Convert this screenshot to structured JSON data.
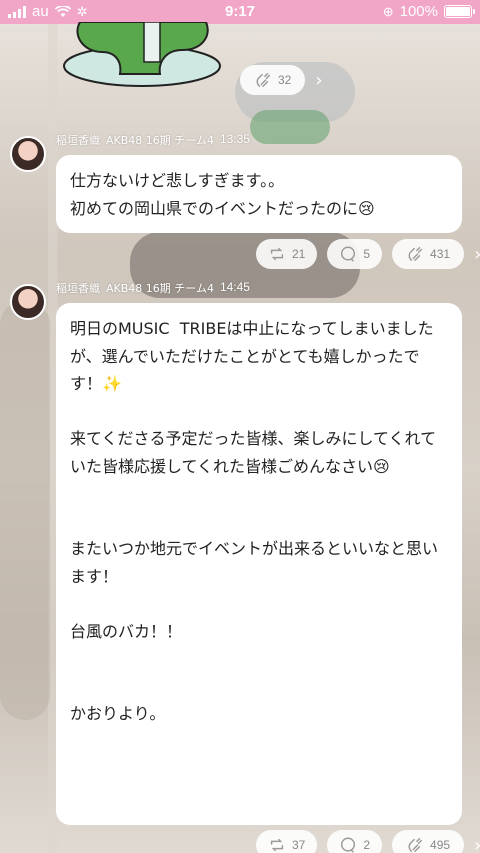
{
  "status_bar": {
    "carrier": "au",
    "time": "9:17",
    "battery": "100%",
    "battery_level": 1.0
  },
  "top_post": {
    "reactions": [
      {
        "icon": "clap-icon",
        "count": "32"
      }
    ]
  },
  "post1": {
    "author": "稲垣香織",
    "group": "AKB48 16期 チーム4",
    "time": "13:35",
    "text_lines": [
      "仕方ないけど悲しすぎます。。",
      "初めての岡山県でのイベントだったのに"
    ],
    "emoji_end": "😢",
    "reactions": [
      {
        "icon": "retweet-icon",
        "count": "21"
      },
      {
        "icon": "comment-icon",
        "count": "5"
      },
      {
        "icon": "clap-icon",
        "count": "431"
      }
    ]
  },
  "post2": {
    "author": "稲垣香織",
    "group": "AKB48 16期 チーム4",
    "time": "14:45",
    "paragraph1": "明日のMUSIC  TRIBEは中止になってしまいましたが、選んでいただけたことがとても嬉しかったです！",
    "sparkle": "✨",
    "paragraph2": "来てくださる予定だった皆様、楽しみにしてくれていた皆様応援してくれた皆様ごめんなさい",
    "emoji2": "😢",
    "paragraph3": "またいつか地元でイベントが出来るといいなと思います！",
    "paragraph4": "台風のバカ！！",
    "paragraph5": "かおりより。",
    "reactions": [
      {
        "icon": "retweet-icon",
        "count": "37"
      },
      {
        "icon": "comment-icon",
        "count": "2"
      },
      {
        "icon": "clap-icon",
        "count": "495"
      }
    ]
  },
  "colors": {
    "status_bar": "#f1a6c7",
    "bubble": "#ffffff",
    "text": "#222222",
    "icon_gray": "#9a9a9a"
  }
}
